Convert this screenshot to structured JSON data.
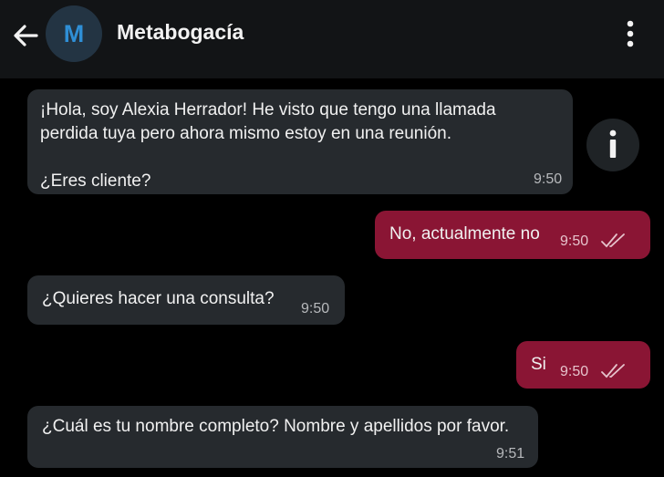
{
  "header": {
    "avatar_letter": "M",
    "title": "Metabogacía"
  },
  "colors": {
    "incoming_bubble": "#262a2e",
    "outgoing_bubble": "#8a1534",
    "avatar_letter": "#2f8fd6"
  },
  "messages": [
    {
      "direction": "in",
      "text": "¡Hola, soy Alexia Herrador! He visto que tengo una llamada\nperdida tuya pero ahora mismo estoy en una reunión.\n\n¿Eres cliente?",
      "time": "9:50"
    },
    {
      "direction": "out",
      "text": "No, actualmente no",
      "time": "9:50",
      "status": "read-double-check"
    },
    {
      "direction": "in",
      "text": "¿Quieres hacer una consulta?",
      "time": "9:50"
    },
    {
      "direction": "out",
      "text": "Si",
      "time": "9:50",
      "status": "read-double-check"
    },
    {
      "direction": "in",
      "text": "¿Cuál es tu nombre completo? Nombre y apellidos por favor.",
      "time": "9:51"
    }
  ],
  "icons": {
    "back": "arrow-left-icon",
    "menu": "more-vertical-icon",
    "info": "info-icon"
  }
}
